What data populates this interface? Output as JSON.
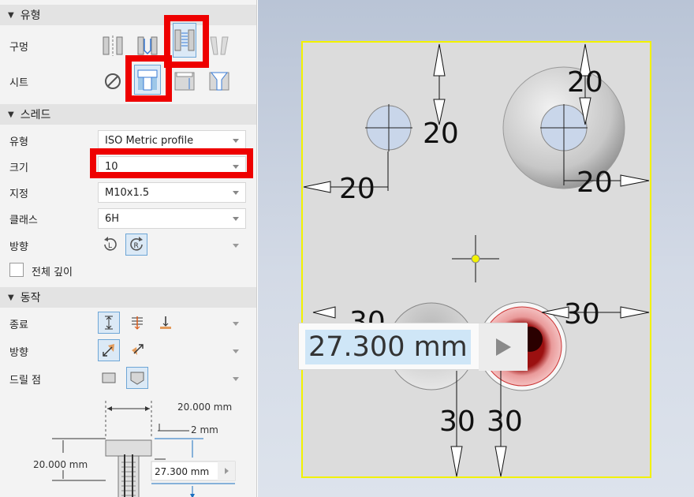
{
  "sections": {
    "type": "유형",
    "thread": "스레드",
    "behavior": "동작"
  },
  "type_section": {
    "hole_label": "구멍",
    "seat_label": "시트"
  },
  "thread_section": {
    "type_label": "유형",
    "type_value": "ISO Metric profile",
    "size_label": "크기",
    "size_value": "10",
    "designation_label": "지정",
    "designation_value": "M10x1.5",
    "class_label": "클래스",
    "class_value": "6H",
    "direction_label": "방향",
    "full_depth_label": "전체 깊이",
    "full_depth_checked": false
  },
  "behavior_section": {
    "termination_label": "종료",
    "direction_label": "방향",
    "drill_point_label": "드릴 점"
  },
  "diagram": {
    "dia_value": "20.000 mm",
    "chamfer_value": "2 mm",
    "depth_value": "20.000 mm",
    "thread_depth_value": "27.300 mm"
  },
  "viewport": {
    "dims": {
      "d1": "20",
      "d2": "20",
      "d3": "20",
      "d4": "20",
      "d5": "30",
      "d6": "30",
      "d7": "30",
      "d8": "30"
    },
    "popup_value": "27.300 mm"
  },
  "colors": {
    "highlight": "#ee0000",
    "selection_bg": "#dbe9f6",
    "selection_border": "#6ea6d6",
    "sketch_outline": "#f2f200",
    "hole_fill": "#c9d6ea",
    "preview_hole": "#e99a9a"
  }
}
